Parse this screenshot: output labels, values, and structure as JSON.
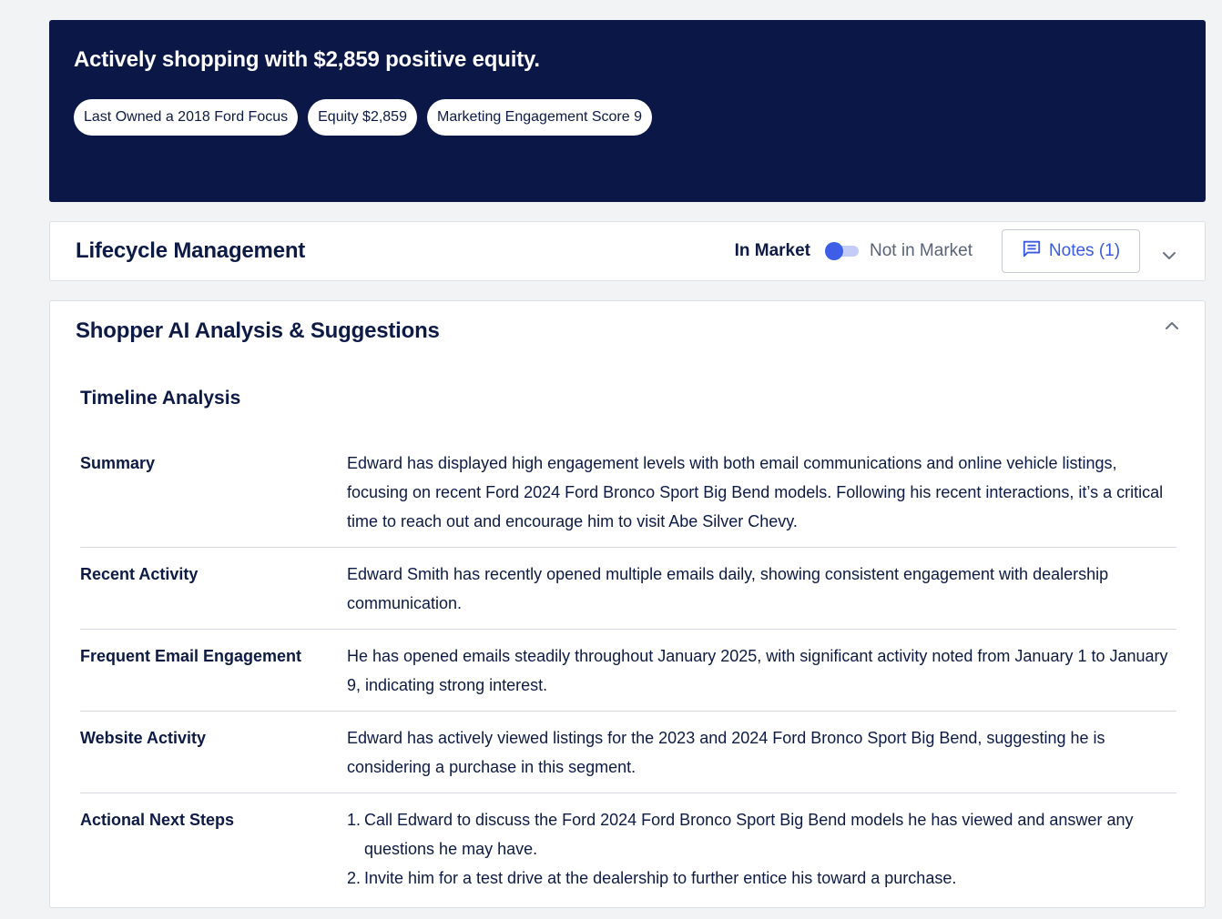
{
  "hero": {
    "title": "Actively shopping with $2,859 positive equity.",
    "chips": [
      "Last Owned a 2018 Ford Focus",
      "Equity $2,859",
      "Marketing Engagement Score 9"
    ]
  },
  "lifecycle": {
    "title": "Lifecycle Management",
    "in_market_label": "In Market",
    "not_in_market_label": "Not in Market",
    "toggle_state": "in-market",
    "notes_label": "Notes (1)"
  },
  "analysis": {
    "title": "Shopper AI Analysis & Suggestions",
    "timeline_title": "Timeline Analysis",
    "rows": [
      {
        "label": "Summary",
        "value": "Edward has displayed high engagement levels with both email communications and online vehicle listings, focusing on recent Ford 2024 Ford Bronco Sport Big Bend models. Following his recent interactions, it’s a critical time to reach out and encourage him to visit Abe Silver Chevy."
      },
      {
        "label": "Recent Activity",
        "value": "Edward Smith has recently opened multiple emails daily, showing consistent engagement with dealership communication."
      },
      {
        "label": "Frequent Email Engagement",
        "value": "He has opened emails steadily throughout January 2025, with significant activity noted from January 1 to January 9, indicating strong interest."
      },
      {
        "label": "Website Activity",
        "value": "Edward has actively viewed listings for the 2023 and 2024 Ford Bronco Sport Big Bend, suggesting he is considering a purchase in this segment."
      }
    ],
    "next_steps": {
      "label": "Actional Next Steps",
      "items": [
        {
          "num": "1.",
          "text": "Call Edward to discuss the Ford 2024 Ford Bronco Sport Big Bend models he has viewed and answer any questions he may have."
        },
        {
          "num": "2.",
          "text": "Invite him for a test drive at the dealership to further entice his toward a purchase."
        }
      ]
    }
  },
  "icons": {
    "notes": "comment-icon",
    "lifecycle_expand": "chevron-down-icon",
    "analysis_collapse": "chevron-up-icon"
  },
  "colors": {
    "hero_bg": "#0b1746",
    "accent": "#3f5ee8"
  }
}
